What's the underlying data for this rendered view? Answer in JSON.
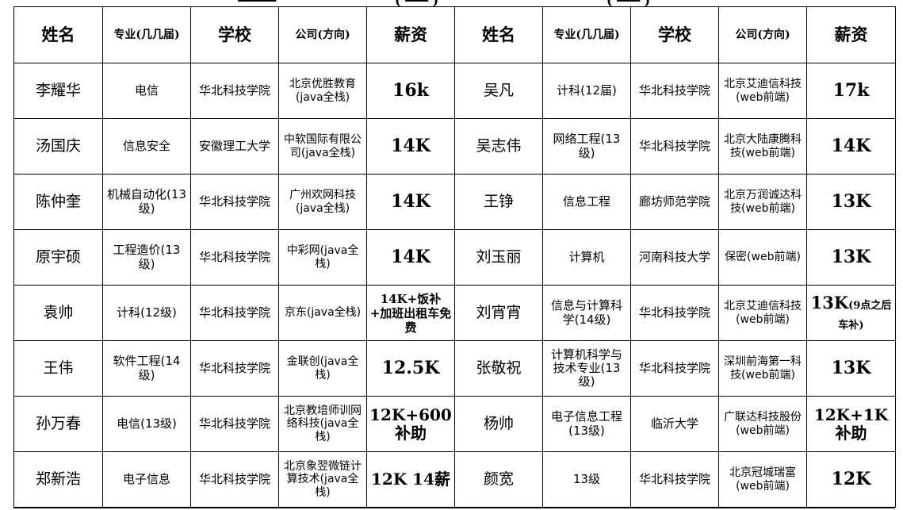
{
  "header": {
    "name": "姓名",
    "major": "专业(几几届)",
    "school": "学校",
    "company": "公司(方向)",
    "salary": "薪资"
  },
  "rows": [
    {
      "left": {
        "name": "李耀华",
        "major": "电信",
        "school": "华北科技学院",
        "company": "北京优胜教育(java全栈)",
        "salary": "16k"
      },
      "right": {
        "name": "吴凡",
        "major": "计科(12届)",
        "school": "华北科技学院",
        "company": "北京艾迪信科技(web前端)",
        "salary": "17k"
      }
    },
    {
      "left": {
        "name": "汤国庆",
        "major": "信息安全",
        "school": "安徽理工大学",
        "company": "中软国际有限公司(java全栈)",
        "salary": "14K"
      },
      "right": {
        "name": "吴志伟",
        "major": "网络工程(13级)",
        "school": "华北科技学院",
        "company": "北京大陆康腾科技(web前端)",
        "salary": "14K"
      }
    },
    {
      "left": {
        "name": "陈仲奎",
        "major": "机械自动化(13级)",
        "school": "华北科技学院",
        "company": "广州欢网科技(java全栈)",
        "salary": "14K"
      },
      "right": {
        "name": "王铮",
        "major": "信息工程",
        "school": "廊坊师范学院",
        "company": "北京万润诚达科技(web前端)",
        "salary": "13K"
      }
    },
    {
      "left": {
        "name": "原宇硕",
        "major": "工程造价(13级)",
        "school": "华北科技学院",
        "company": "中彩网(java全栈)",
        "salary": "14K"
      },
      "right": {
        "name": "刘玉丽",
        "major": "计算机",
        "school": "河南科技大学",
        "company": "保密(web前端)",
        "salary": "13K"
      }
    },
    {
      "left": {
        "name": "袁帅",
        "major": "计科(12级)",
        "school": "华北科技学院",
        "company": "京东(java全栈)",
        "salary": "14K+饭补+加班出租车免费"
      },
      "right": {
        "name": "刘宵宵",
        "major": "信息与计算科学(14级)",
        "school": "华北科技学院",
        "company": "北京艾迪信科技(web前端)",
        "salary": "13K",
        "salary_note": "(9点之后车补)"
      }
    },
    {
      "left": {
        "name": "王伟",
        "major": "软件工程(14级)",
        "school": "华北科技学院",
        "company": "金联创(java全栈)",
        "salary": "12.5K"
      },
      "right": {
        "name": "张敬祝",
        "major": "计算机科学与技术专业(13级)",
        "school": "华北科技学院",
        "company": "深圳前海第一科技(web前端)",
        "salary": "13K"
      }
    },
    {
      "left": {
        "name": "孙万春",
        "major": "电信(13级)",
        "school": "华北科技学院",
        "company": "北京教培师训网络科技(java全栈)",
        "salary": "12K+600补助"
      },
      "right": {
        "name": "杨帅",
        "major": "电子信息工程(13级)",
        "school": "临沂大学",
        "company": "广联达科技股份(web前端)",
        "salary": "12K+1K补助"
      }
    },
    {
      "left": {
        "name": "郑新浩",
        "major": "电子信息",
        "school": "华北科技学院",
        "company": "北京象翌微链计算技术(java全栈)",
        "salary": "12K 14薪"
      },
      "right": {
        "name": "颜宽",
        "major": "13级",
        "school": "华北科技学院",
        "company": "北京冠城瑞富(web前端)",
        "salary": "12K"
      }
    }
  ]
}
